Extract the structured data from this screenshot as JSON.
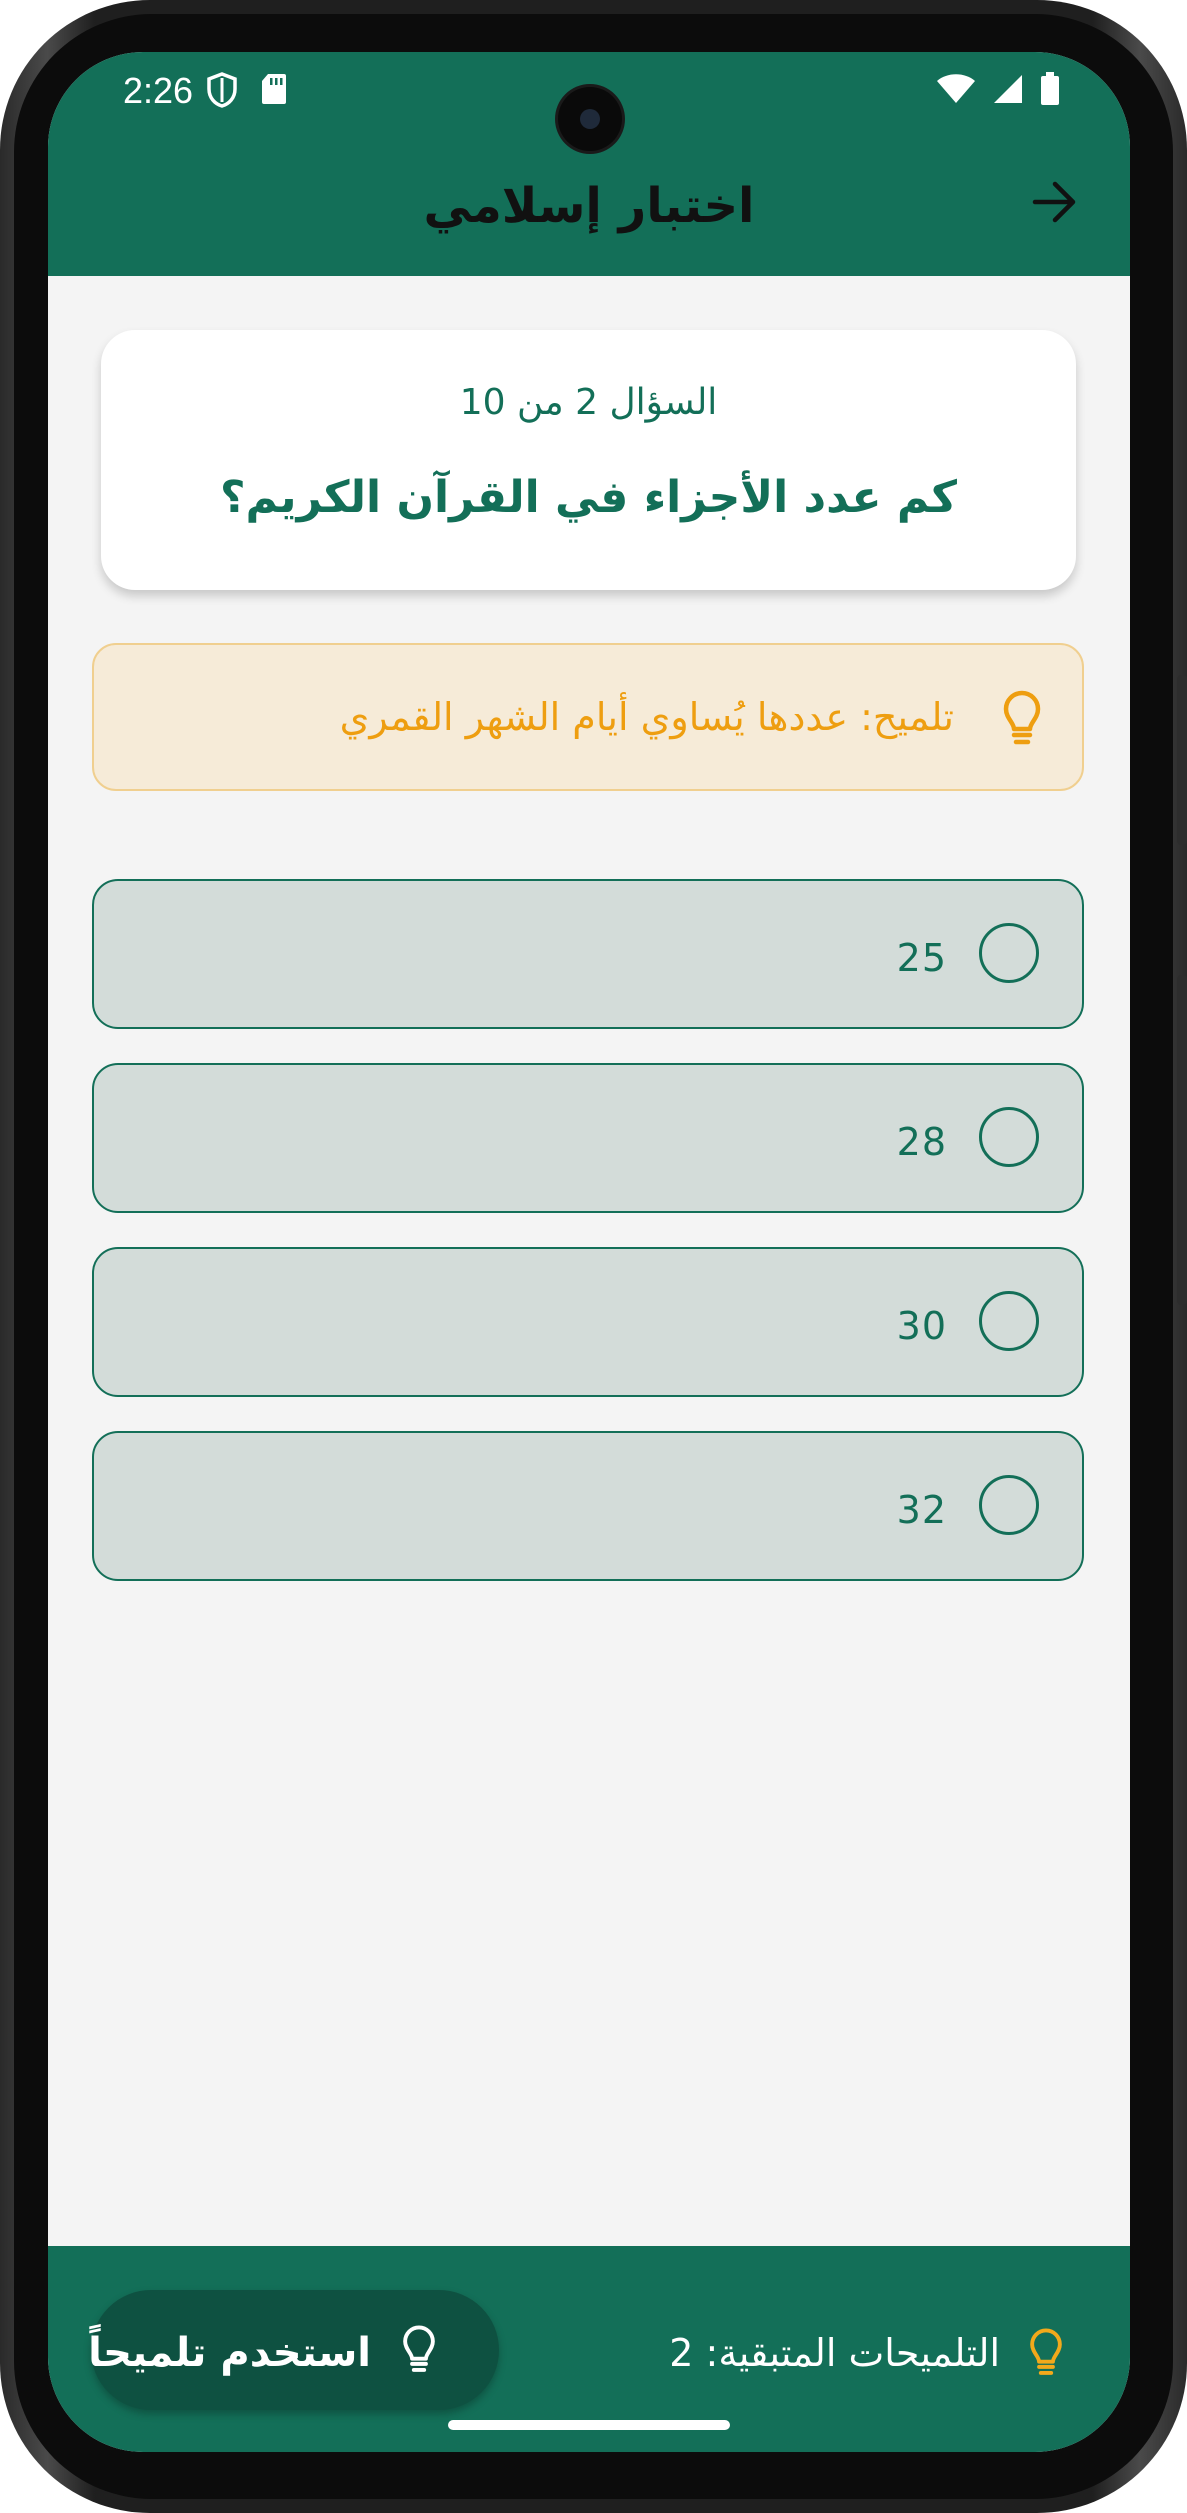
{
  "status_bar": {
    "time": "2:26"
  },
  "app_bar": {
    "title": "اختبار إسلامي",
    "back_icon": "arrow-right-icon"
  },
  "question": {
    "counter": "السؤال 2 من 10",
    "text": "كم عدد الأجزاء في القرآن الكريم؟"
  },
  "hint": {
    "icon": "lightbulb-icon",
    "text": "تلميح: عددها يُساوي أيام الشهر القمري"
  },
  "options": [
    {
      "label": "25",
      "selected": false
    },
    {
      "label": "28",
      "selected": false
    },
    {
      "label": "30",
      "selected": false
    },
    {
      "label": "32",
      "selected": false
    }
  ],
  "bottom_bar": {
    "remaining_hints": "التلميحات المتبقية: 2",
    "use_hint_label": "استخدم تلميحاً"
  },
  "colors": {
    "primary": "#136f58",
    "accent": "#ee9e10",
    "option_bg": "#d3dcd9",
    "hint_bg": "#f6ebd8"
  }
}
